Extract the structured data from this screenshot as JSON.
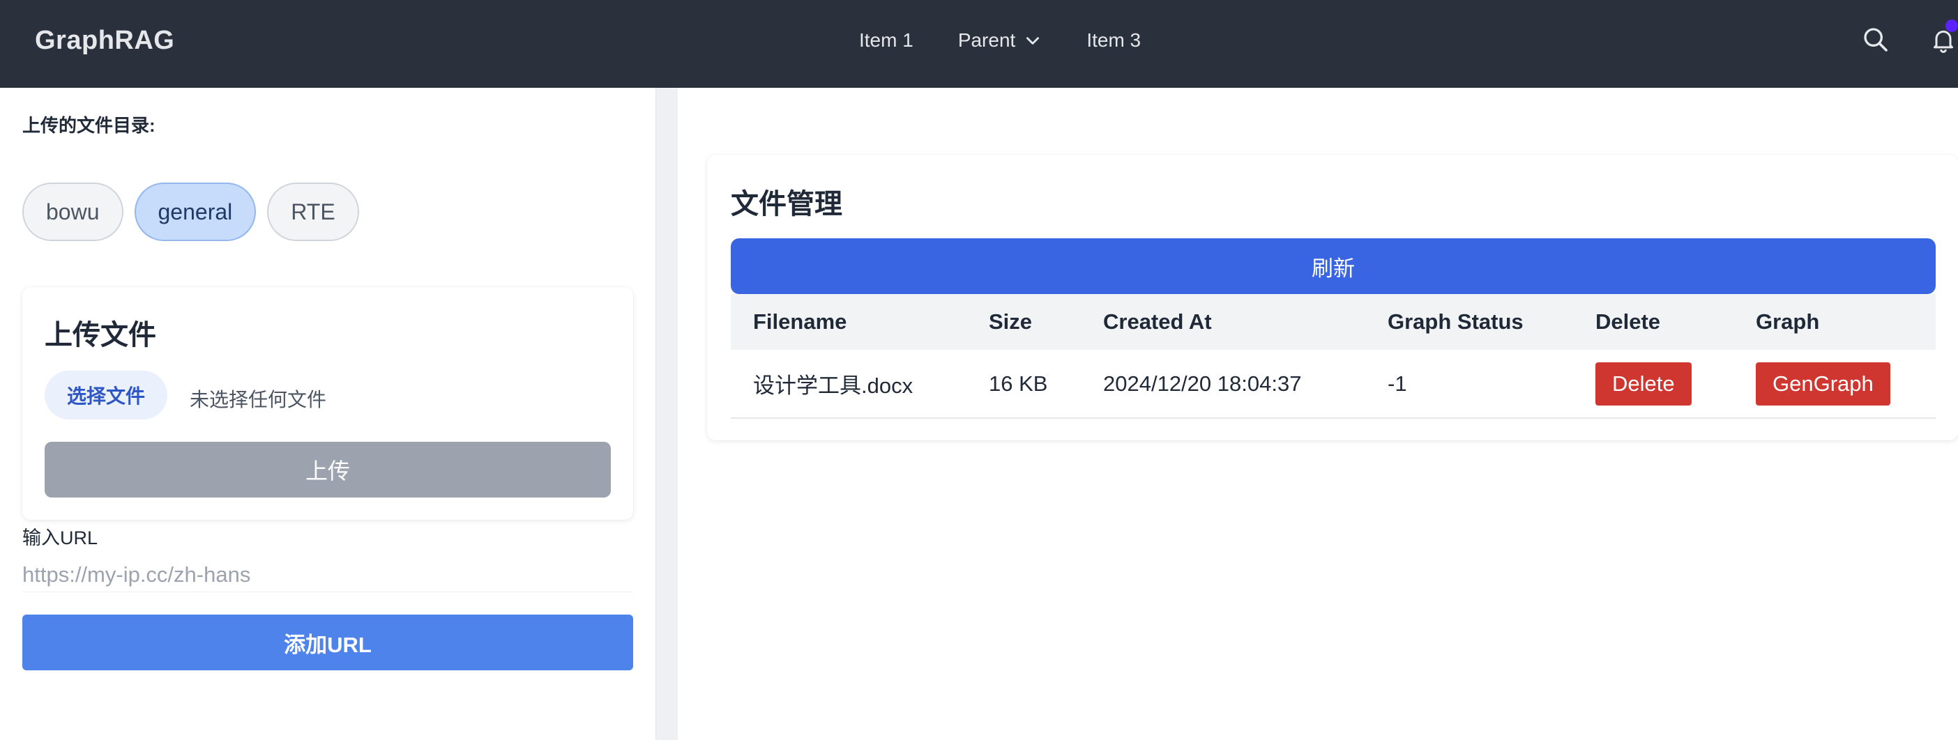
{
  "app": {
    "brand": "GraphRAG"
  },
  "nav": {
    "items": [
      {
        "label": "Item 1"
      },
      {
        "label": "Parent"
      },
      {
        "label": "Item 3"
      }
    ]
  },
  "left": {
    "section_label": "上传的文件目录:",
    "directories": [
      {
        "label": "bowu",
        "active": false
      },
      {
        "label": "general",
        "active": true
      },
      {
        "label": "RTE",
        "active": false
      }
    ],
    "upload": {
      "title": "上传文件",
      "choose_label": "选择文件",
      "no_file_label": "未选择任何文件",
      "upload_label": "上传"
    },
    "url": {
      "label": "输入URL",
      "placeholder": "https://my-ip.cc/zh-hans",
      "add_label": "添加URL"
    }
  },
  "right": {
    "title": "文件管理",
    "refresh_label": "刷新",
    "table": {
      "columns": [
        "Filename",
        "Size",
        "Created At",
        "Graph Status",
        "Delete",
        "Graph"
      ],
      "rows": [
        {
          "filename": "设计学工具.docx",
          "size": "16 KB",
          "created_at": "2024/12/20 18:04:37",
          "graph_status": "-1",
          "delete_label": "Delete",
          "graph_label": "GenGraph"
        }
      ]
    }
  },
  "colors": {
    "navbar": "#2a303c",
    "primary": "#3965e2",
    "danger": "#d03630",
    "chip_active": "#c7dbfb"
  },
  "icons": [
    "search-icon",
    "bell-icon",
    "chevron-down-icon"
  ]
}
